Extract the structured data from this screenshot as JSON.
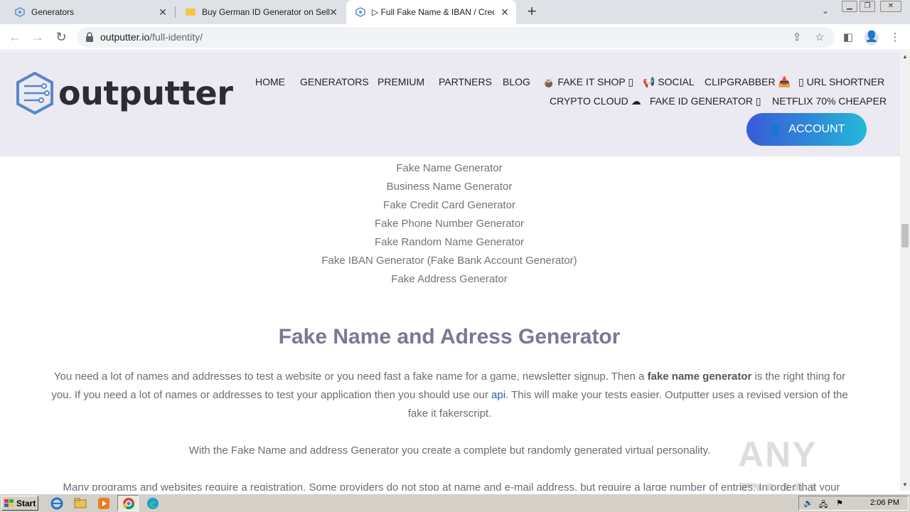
{
  "browser": {
    "tabs": [
      {
        "title": "Generators",
        "active": false
      },
      {
        "title": "Buy German ID Generator on SellApp",
        "active": false
      },
      {
        "title": "▷ Full Fake Name & IBAN / Credit Card",
        "active": true
      }
    ],
    "url_host": "outputter.io",
    "url_path": "/full-identity/"
  },
  "site": {
    "logo_text": "outputter",
    "nav_row1": [
      "HOME",
      "GENERATORS",
      "PREMIUM",
      "PARTNERS",
      "BLOG",
      "🧉 FAKE IT SHOP ▯",
      "📢 SOCIAL",
      "CLIPGRABBER 📥",
      "▯ URL SHORTNER"
    ],
    "nav_row2": [
      "CRYPTO CLOUD ☁",
      "FAKE ID GENERATOR ▯",
      "NETFLIX 70% CHEAPER"
    ],
    "account_label": "ACCOUNT"
  },
  "content": {
    "generator_links": [
      "Fake Name Generator",
      "Business Name Generator",
      "Fake Credit Card Generator",
      "Fake Phone Number Generator",
      "Fake Random Name Generator",
      "Fake IBAN Generator (Fake Bank Account Generator)",
      "Fake Address Generator"
    ],
    "heading": "Fake Name and Adress Generator",
    "para1_a": "You need a lot of names and addresses to test a website or you need fast a fake name for a game, newsletter signup. Then a ",
    "para1_bold": "fake name generator",
    "para1_b": " is the right thing for you. If you need a lot of names or addresses to test your application then you should use our ",
    "para1_link": "api",
    "para1_c": ". This will make your tests easier. Outputter uses a revised version of the fake it fakerscript.",
    "para2": "With the Fake Name and address Generator you create a complete but randomly generated virtual personality.",
    "para3": "Many programs and websites require a registration. Some providers do not stop at name and e-mail address, but require a large number of entries. In order that your"
  },
  "watermark": "ANY RUN",
  "taskbar": {
    "start_label": "Start",
    "clock": "2:06 PM"
  }
}
